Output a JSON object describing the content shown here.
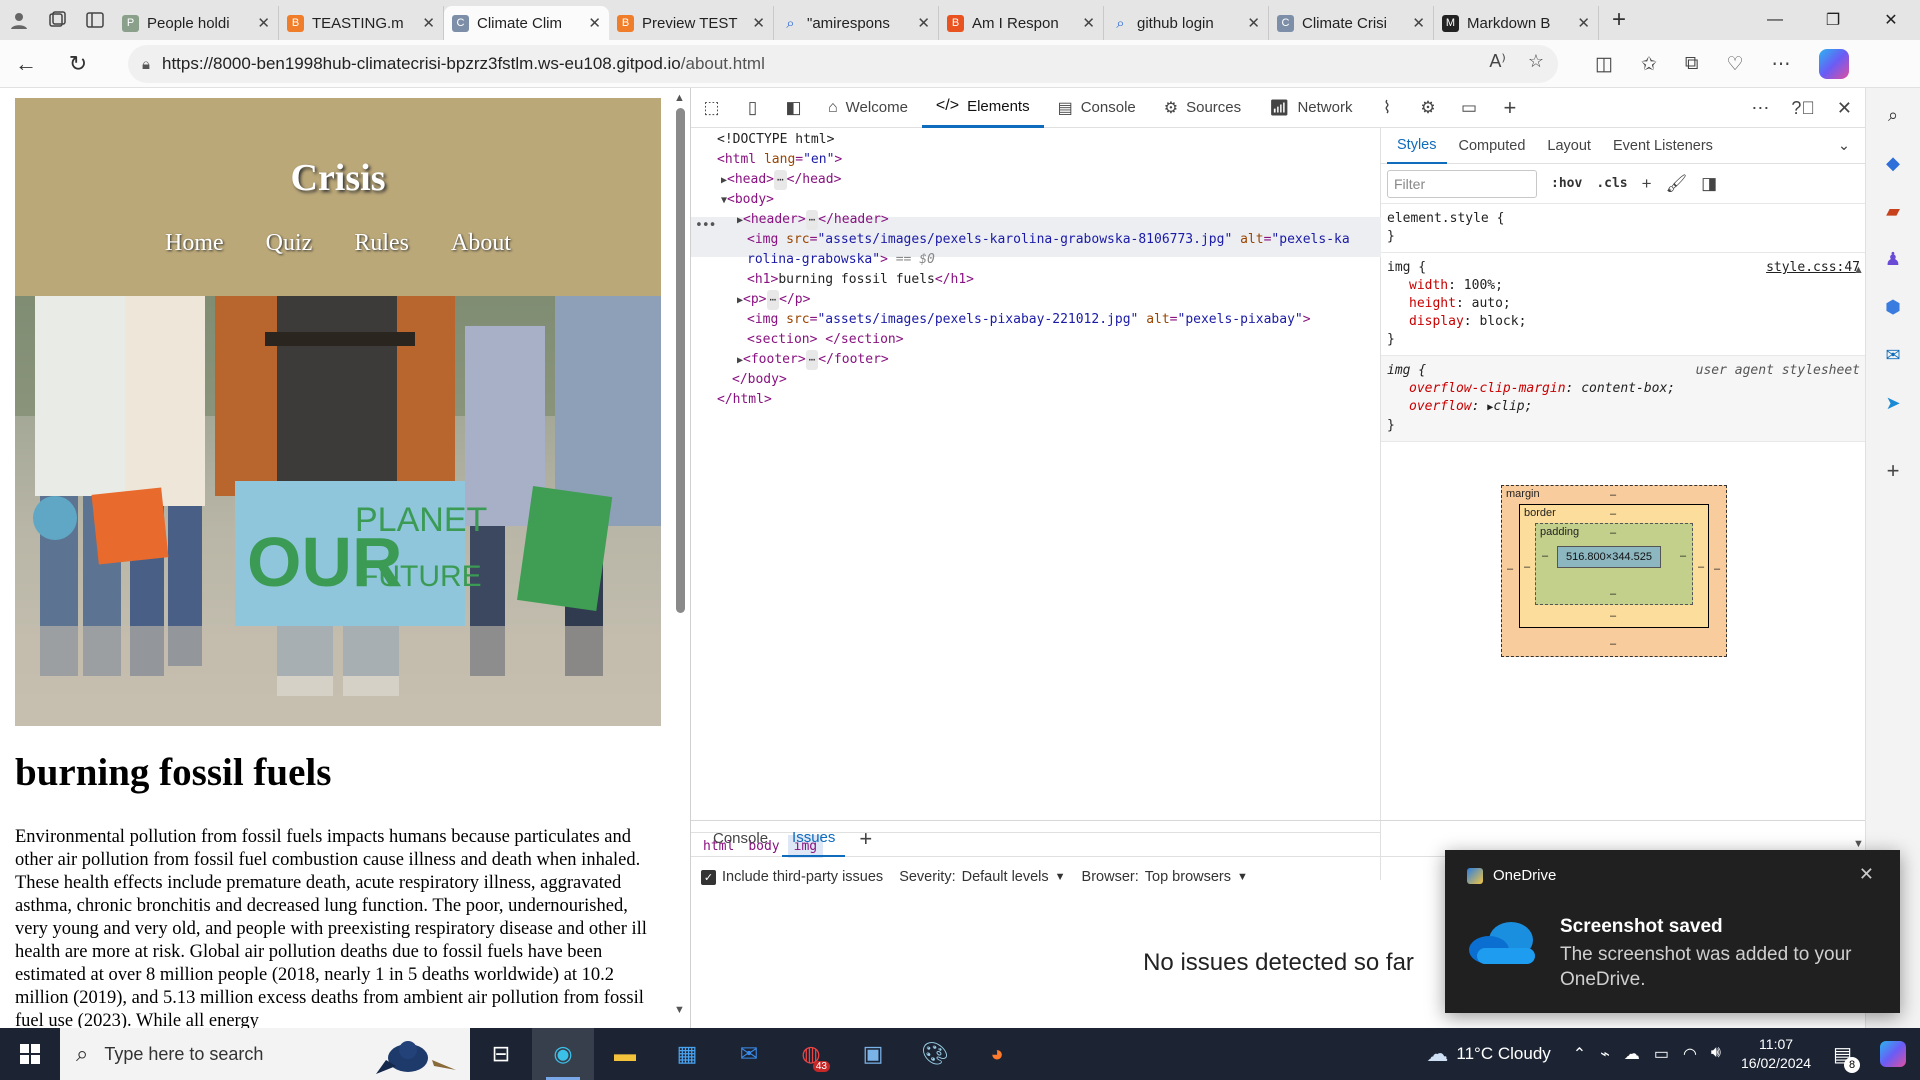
{
  "browser": {
    "tabs": [
      {
        "title": "People holdi",
        "active": false,
        "color": "#8aa08a"
      },
      {
        "title": "TEASTING.m",
        "active": false,
        "color": "#f07d2a"
      },
      {
        "title": "Climate Clim",
        "active": true,
        "color": "#7d8fa8"
      },
      {
        "title": "Preview TEST",
        "active": false,
        "color": "#f07d2a"
      },
      {
        "title": "\"amirespons",
        "active": false,
        "color": "#2d6ad6"
      },
      {
        "title": "Am I Respon",
        "active": false,
        "color": "#e8531f"
      },
      {
        "title": "github login",
        "active": false,
        "color": "#2d6ad6"
      },
      {
        "title": "Climate Crisi",
        "active": false,
        "color": "#7d8fa8"
      },
      {
        "title": "Markdown B",
        "active": false,
        "color": "#222222"
      }
    ],
    "url_host": "https://8000-ben1998hub-climatecrisi-bpzrz3fstlm.ws-eu108.gitpod.io",
    "url_path": "/about.html"
  },
  "page": {
    "site_title": "Crisis",
    "nav": [
      "Home",
      "Quiz",
      "Rules",
      "About"
    ],
    "hero_alt": "pexels-karolina-grabowska",
    "heading": "burning fossil fuels",
    "paragraph": "Environmental pollution from fossil fuels impacts humans because particulates and other air pollution from fossil fuel combustion cause illness and death when inhaled. These health effects include premature death, acute respiratory illness, aggravated asthma, chronic bronchitis and decreased lung function. The poor, undernourished, very young and very old, and people with preexisting respiratory disease and other ill health are more at risk. Global air pollution deaths due to fossil fuels have been estimated at over 8 million people (2018, nearly 1 in 5 deaths worldwide) at 10.2 million (2019), and 5.13 million excess deaths from ambient air pollution from fossil fuel use (2023). While all energy"
  },
  "devtools": {
    "tabs": [
      "Welcome",
      "Elements",
      "Console",
      "Sources",
      "Network"
    ],
    "active_tab": "Elements",
    "dom": {
      "doctype": "<!DOCTYPE html>",
      "html_open": "<html",
      "lang_attr": "lang",
      "lang_val": "\"en\"",
      "head": "<head>",
      "head_close": "</head>",
      "body": "<body>",
      "header": "<header>",
      "header_close": "</header>",
      "img_open": "<img",
      "src_attr": "src",
      "img1_src": "\"assets/images/pexels-karolina-grabowska-8106773.jpg\"",
      "alt_attr": "alt",
      "img1_alt_a": "\"pexels-ka",
      "img1_alt_b": "rolina-grabowska\"",
      "img_close": ">",
      "eq0": "== $0",
      "h1_line": "burning fossil fuels",
      "p_open": "<p>",
      "p_close": "</p>",
      "img2_src": "\"assets/images/pexels-pixabay-221012.jpg\"",
      "img2_alt": "\"pexels-pixabay\"",
      "section": "<section>",
      "section_close": "</section>",
      "footer": "<footer>",
      "footer_close": "</footer>",
      "body_close": "</body>",
      "html_close": "</html>"
    },
    "breadcrumbs": [
      "html",
      "body",
      "img"
    ],
    "styles_tabs": [
      "Styles",
      "Computed",
      "Layout",
      "Event Listeners"
    ],
    "filter_placeholder": "Filter",
    "hov": ":hov",
    "cls": ".cls",
    "element_style": "element.style {",
    "rule1": {
      "selector": "img {",
      "source": "style.css:47",
      "props": [
        {
          "name": "width",
          "value": "100%;"
        },
        {
          "name": "height",
          "value": "auto;"
        },
        {
          "name": "display",
          "value": "block;"
        }
      ]
    },
    "rule2": {
      "selector": "img {",
      "source": "user agent stylesheet",
      "props": [
        {
          "name": "overflow-clip-margin",
          "value": "content-box;"
        },
        {
          "name": "overflow",
          "value": "clip;"
        }
      ]
    },
    "close_brace": "}",
    "boxmodel": {
      "margin": "margin",
      "border": "border",
      "padding": "padding",
      "content": "516.800×344.525",
      "dash": "–"
    },
    "drawer_tabs": [
      "Console",
      "Issues"
    ],
    "drawer_active": "Issues",
    "include_third_party": "Include third-party issues",
    "severity_label": "Severity:",
    "severity_value": "Default levels",
    "browser_label": "Browser:",
    "browser_value": "Top browsers",
    "no_issues": "No issues detected so far"
  },
  "toast": {
    "app": "OneDrive",
    "title": "Screenshot saved",
    "body": "The screenshot was added to your OneDrive."
  },
  "taskbar": {
    "search_placeholder": "Type here to search",
    "weather": "11°C  Cloudy",
    "time": "11:07",
    "date": "16/02/2024",
    "notification_count": "8",
    "paint_badge": "43"
  }
}
